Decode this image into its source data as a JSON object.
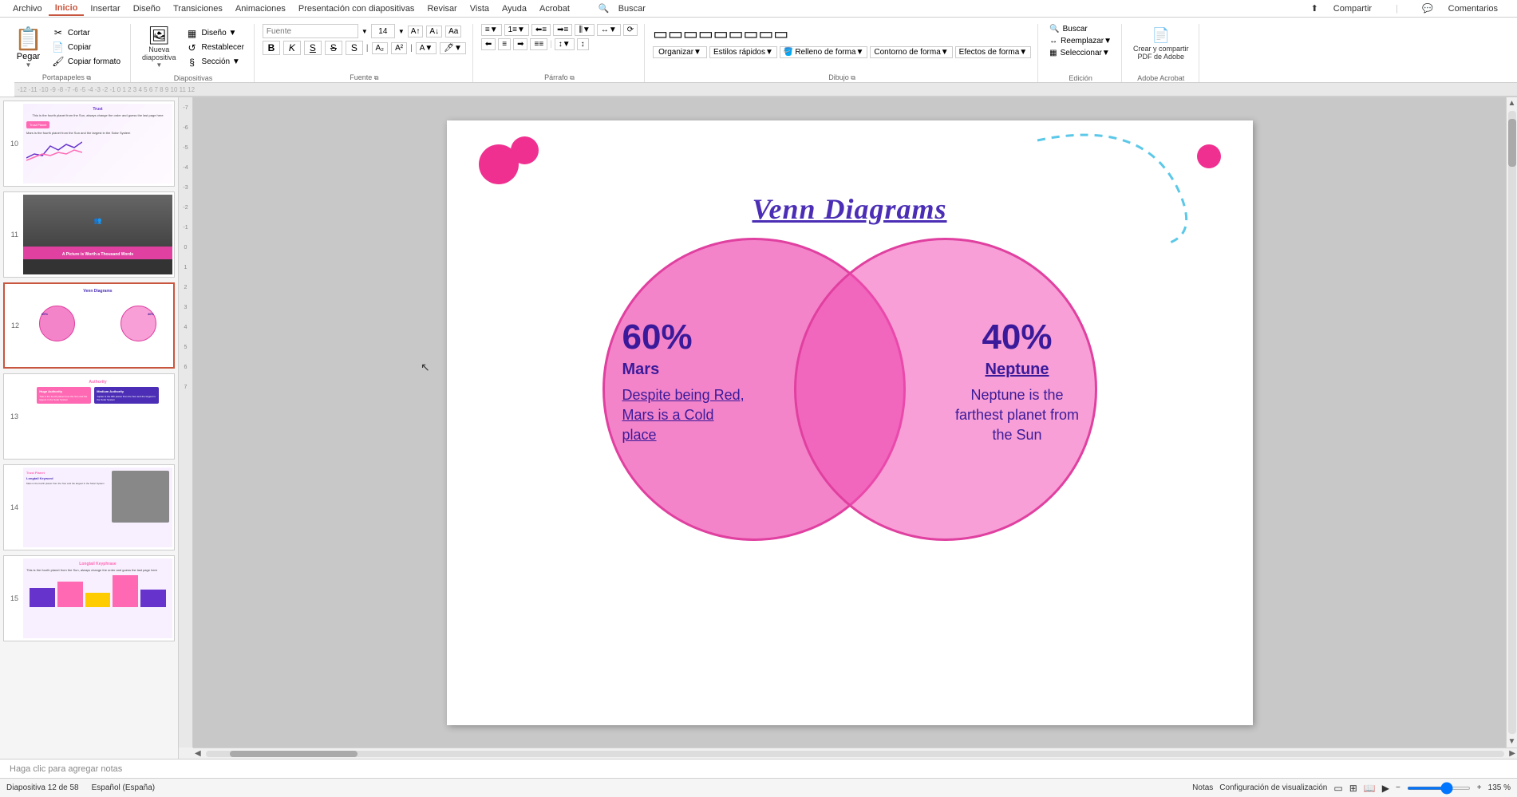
{
  "app": {
    "title": "PowerPoint"
  },
  "menubar": {
    "items": [
      {
        "label": "Archivo",
        "active": false
      },
      {
        "label": "Inicio",
        "active": true
      },
      {
        "label": "Insertar",
        "active": false
      },
      {
        "label": "Diseño",
        "active": false
      },
      {
        "label": "Transiciones",
        "active": false
      },
      {
        "label": "Animaciones",
        "active": false
      },
      {
        "label": "Presentación con diapositivas",
        "active": false
      },
      {
        "label": "Revisar",
        "active": false
      },
      {
        "label": "Vista",
        "active": false
      },
      {
        "label": "Ayuda",
        "active": false
      },
      {
        "label": "Acrobat",
        "active": false
      },
      {
        "label": "Buscar",
        "active": false
      }
    ],
    "share": "Compartir",
    "comments": "Comentarios"
  },
  "ribbon": {
    "groups": [
      {
        "label": "Portapapeles",
        "buttons": [
          {
            "label": "Pegar",
            "icon": "📋"
          },
          {
            "label": "Cortar",
            "icon": "✂"
          },
          {
            "label": "Copiar",
            "icon": "📄"
          },
          {
            "label": "Copiar formato",
            "icon": "🖌"
          }
        ]
      },
      {
        "label": "Diapositivas",
        "buttons": [
          {
            "label": "Nueva diapositiva",
            "icon": "➕"
          },
          {
            "label": "Diseño",
            "icon": "▦"
          },
          {
            "label": "Restablecer",
            "icon": "↺"
          },
          {
            "label": "Sección",
            "icon": "§"
          }
        ]
      },
      {
        "label": "Fuente",
        "fontName": "",
        "fontSize": "14",
        "buttons": [
          "B",
          "K",
          "S",
          "S̶",
          "A",
          "A"
        ]
      },
      {
        "label": "Párrafo",
        "buttons": [
          "≡",
          "≡",
          "≡",
          "≡"
        ]
      },
      {
        "label": "Dibujo",
        "buttons": []
      },
      {
        "label": "Edición",
        "buttons": [
          {
            "label": "Buscar",
            "icon": "🔍"
          },
          {
            "label": "Reemplazar",
            "icon": "↔"
          },
          {
            "label": "Seleccionar",
            "icon": "▦"
          }
        ]
      },
      {
        "label": "Adobe Acrobat",
        "buttons": [
          {
            "label": "Crear y compartir PDF de Adobe",
            "icon": "📄"
          }
        ]
      }
    ]
  },
  "slides": [
    {
      "num": "10",
      "label": "Trust slide",
      "active": false
    },
    {
      "num": "11",
      "label": "A Picture is Worth a Thousand Words",
      "active": false
    },
    {
      "num": "12",
      "label": "Venn Diagrams",
      "active": true
    },
    {
      "num": "13",
      "label": "Authority",
      "active": false
    },
    {
      "num": "14",
      "label": "Longtail Keyword",
      "active": false
    },
    {
      "num": "15",
      "label": "Longtail Keyphrase",
      "active": false
    }
  ],
  "current_slide": {
    "title": "Venn Diagrams",
    "left_circle": {
      "percent": "60%",
      "planet": "Mars",
      "description": "Despite being Red, Mars is a Cold place"
    },
    "right_circle": {
      "percent": "40%",
      "planet": "Neptune",
      "description": "Neptune is the farthest planet from the Sun"
    }
  },
  "bottom_bar": {
    "slide_info": "Diapositiva 12 de 58",
    "language": "Español (España)",
    "notes_label": "Notas",
    "view_settings": "Configuración de visualización",
    "zoom": "135 %",
    "notes_text": "Haga clic para agregar notas"
  }
}
